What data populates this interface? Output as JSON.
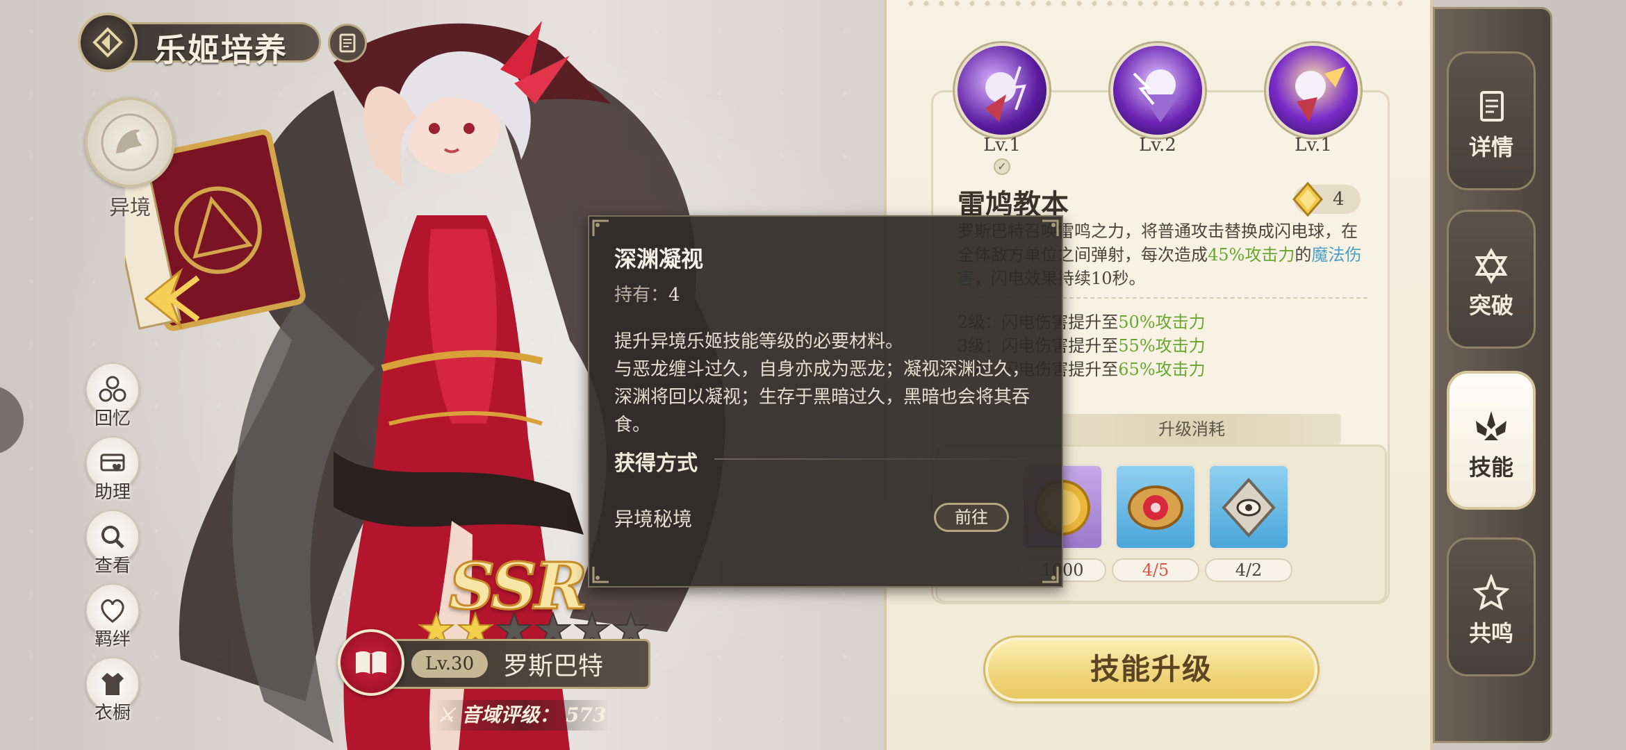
{
  "header": {
    "title": "乐姬培养"
  },
  "left_nav": {
    "realm_label": "异境",
    "items": [
      {
        "label": "回忆",
        "icon": "memory-icon"
      },
      {
        "label": "助理",
        "icon": "assistant-icon"
      },
      {
        "label": "查看",
        "icon": "view-icon"
      },
      {
        "label": "羁绊",
        "icon": "bond-icon"
      },
      {
        "label": "衣橱",
        "icon": "wardrobe-icon"
      }
    ]
  },
  "character": {
    "rarity": "SSR",
    "stars_total": 6,
    "stars_filled": 2,
    "level": "Lv.30",
    "name": "罗斯巴特",
    "rating": "音域评级： 573"
  },
  "skills": {
    "tabs": [
      {
        "level": "Lv.1"
      },
      {
        "level": "Lv.2"
      },
      {
        "level": "Lv.1"
      }
    ],
    "selected_name": "雷鸠教本",
    "owned_count": "4",
    "desc_prefix": "罗斯巴特召唤雷鸣之力，将普通攻击替换成闪电球，在全体敌方单位之间弹射，每次造成",
    "desc_percent": "45%攻击力",
    "desc_mid": "的",
    "desc_dmg_type": "魔法伤害",
    "desc_suffix": "，闪电效果持续10秒。",
    "upgrades": [
      {
        "prefix": "2级：闪电伤害提升至",
        "value": "50%攻击力"
      },
      {
        "prefix": "3级：闪电伤害提升至",
        "value": "55%攻击力"
      },
      {
        "prefix": "4级：闪电伤害提升至",
        "value": "65%攻击力"
      }
    ],
    "cost_label": "升级消耗",
    "costs": [
      {
        "count": "1000",
        "icon": "gold-coin-icon"
      },
      {
        "count": "4/5",
        "icon": "abyss-eye-icon"
      },
      {
        "count": "4/2",
        "icon": "emblem-icon"
      }
    ],
    "upgrade_button": "技能升级"
  },
  "side_tabs": [
    {
      "label": "详情",
      "icon": "details-icon"
    },
    {
      "label": "突破",
      "icon": "breakthrough-icon"
    },
    {
      "label": "技能",
      "icon": "skill-icon",
      "active": true
    },
    {
      "label": "共鸣",
      "icon": "resonance-icon"
    }
  ],
  "tooltip": {
    "title": "深渊凝视",
    "own_label": "持有：",
    "own_value": "4",
    "desc_line1": "提升异境乐姬技能等级的必要材料。",
    "desc_line2": "与恶龙缠斗过久，自身亦成为恶龙；凝视深渊过久，深渊将回以凝视；生存于黑暗过久，黑暗也会将其吞食。",
    "obtain_title": "获得方式",
    "source": "异境秘境",
    "go_button": "前往"
  },
  "colors": {
    "accent_gold": "#f0d57a",
    "highlight_green": "#6aa52f",
    "highlight_blue": "#4aa0c8",
    "cost_red": "#d9534f"
  }
}
